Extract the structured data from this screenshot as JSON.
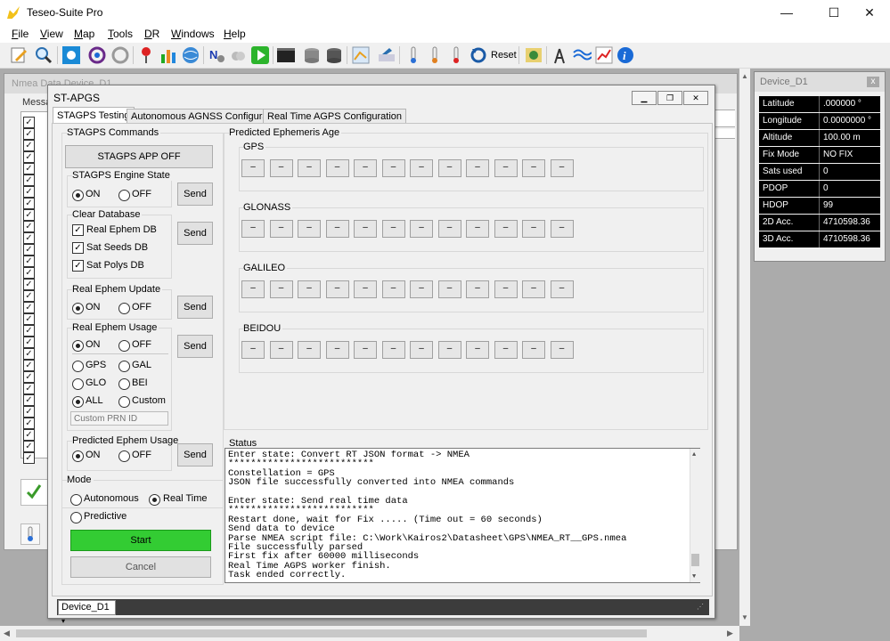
{
  "app": {
    "title": "Teseo-Suite Pro"
  },
  "window_controls": {
    "minimize": "—",
    "maximize": "☐",
    "close": "✕"
  },
  "menu": [
    {
      "label": "File",
      "u": "F",
      "rest": "ile"
    },
    {
      "label": "View",
      "u": "V",
      "rest": "iew"
    },
    {
      "label": "Map",
      "u": "M",
      "rest": "ap"
    },
    {
      "label": "Tools",
      "u": "T",
      "rest": "ools"
    },
    {
      "label": "DR",
      "u": "D",
      "rest": "R"
    },
    {
      "label": "Windows",
      "u": "W",
      "rest": "indows"
    },
    {
      "label": "Help",
      "u": "H",
      "rest": "elp"
    }
  ],
  "toolbar": {
    "reset_label": "Reset"
  },
  "bgwindow": {
    "title": "Nmea Data Device_D1",
    "tab": "Messages"
  },
  "device_panel": {
    "title": "Device_D1",
    "close": "x",
    "rows": [
      {
        "k": "Latitude",
        "v": ".000000 °"
      },
      {
        "k": "Longitude",
        "v": "0.0000000 °"
      },
      {
        "k": "Altitude",
        "v": "100.00 m"
      },
      {
        "k": "Fix Mode",
        "v": "NO FIX"
      },
      {
        "k": "Sats used",
        "v": "0"
      },
      {
        "k": "PDOP",
        "v": "0"
      },
      {
        "k": "HDOP",
        "v": "99"
      },
      {
        "k": "2D Acc.",
        "v": "4710598.36"
      },
      {
        "k": "3D Acc.",
        "v": "4710598.36"
      }
    ]
  },
  "dialog": {
    "title": "ST-APGS",
    "tabs": [
      "STAGPS Testing",
      "Autonomous AGNSS Configuration",
      "Real Time AGPS Configuration"
    ],
    "stagps_commands": "STAGPS Commands",
    "app_off": "STAGPS APP OFF",
    "engine_state": {
      "label": "STAGPS Engine State",
      "on": "ON",
      "off": "OFF"
    },
    "send": "Send",
    "clear_db": {
      "label": "Clear Database",
      "items": [
        "Real Ephem DB",
        "Sat Seeds DB",
        "Sat Polys DB"
      ]
    },
    "real_ephem_update": {
      "label": "Real Ephem Update",
      "on": "ON",
      "off": "OFF"
    },
    "real_ephem_usage": {
      "label": "Real Ephem Usage",
      "on": "ON",
      "off": "OFF",
      "gps": "GPS",
      "gal": "GAL",
      "glo": "GLO",
      "bei": "BEI",
      "all": "ALL",
      "custom": "Custom",
      "prn_placeholder": "Custom PRN ID"
    },
    "predicted_usage": {
      "label": "Predicted Ephem Usage",
      "on": "ON",
      "off": "OFF"
    },
    "mode": {
      "label": "Mode",
      "autonomous": "Autonomous",
      "real_time": "Real Time",
      "predictive": "Predictive"
    },
    "start": "Start",
    "cancel": "Cancel",
    "ephem_age": {
      "label": "Predicted Ephemeris Age",
      "groups": [
        "GPS",
        "GLONASS",
        "GALILEO",
        "BEIDOU"
      ],
      "cell": "–"
    },
    "status": {
      "label": "Status",
      "lines": [
        "Enter state: Convert RT JSON format -> NMEA",
        "**************************",
        "Constellation = GPS",
        "JSON file successfully converted into NMEA commands",
        "",
        "Enter state: Send real time data",
        "**************************",
        "Restart done, wait for Fix ..... (Time out = 60 seconds)",
        "Send data to device",
        "Parse NMEA script file: C:\\Work\\Kairos2\\Datasheet\\GPS\\NMEA_RT__GPS.nmea",
        "File successfully parsed",
        "First fix after 60000 milliseconds",
        "Real Time AGPS worker finish.",
        "Task ended correctly."
      ]
    },
    "device_selector": "Device_D1"
  },
  "colors": {
    "start_green": "#33cc33",
    "panel_black": "#000000"
  }
}
